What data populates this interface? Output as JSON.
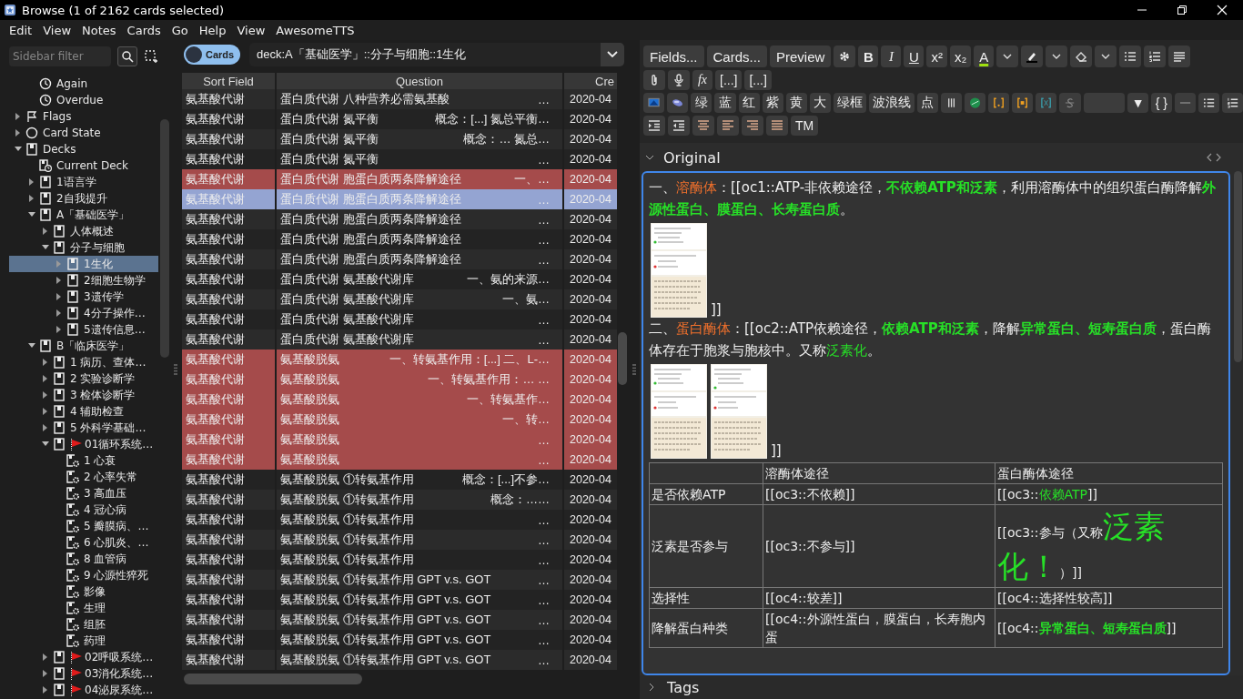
{
  "window": {
    "title": "Browse (1 of 2162 cards selected)"
  },
  "menu": [
    "Edit",
    "View",
    "Notes",
    "Cards",
    "Go",
    "Help",
    "View",
    "AwesomeTTS"
  ],
  "sidebar": {
    "filter": {
      "placeholder": "Sidebar filter"
    },
    "continued_items": [
      {
        "kind": "saved-search",
        "label": "Again",
        "selected": false
      },
      {
        "kind": "saved-search",
        "label": "Overdue",
        "selected": false
      }
    ],
    "items": [
      {
        "kind": "flag",
        "label": "Flags",
        "expanded": false,
        "selected": false
      },
      {
        "kind": "card-state",
        "label": "Card State",
        "expanded": false,
        "selected": false
      },
      {
        "kind": "deck",
        "label": "Decks",
        "expanded": true,
        "selected": false,
        "children": [
          {
            "kind": "current-deck",
            "label": "Current Deck",
            "selected": false
          },
          {
            "kind": "deck",
            "label": "1语言学",
            "expanded": false,
            "selected": false
          },
          {
            "kind": "deck",
            "label": "2自我提升",
            "expanded": false,
            "selected": false
          },
          {
            "kind": "deck",
            "label": "A「基础医学」",
            "expanded": true,
            "selected": false,
            "children": [
              {
                "kind": "deck",
                "label": "人体概述",
                "expanded": false,
                "selected": false
              },
              {
                "kind": "deck",
                "label": "分子与细胞",
                "expanded": true,
                "selected": false,
                "children": [
                  {
                    "kind": "deck",
                    "label": "1生化",
                    "expanded": false,
                    "selected": true
                  },
                  {
                    "kind": "deck",
                    "label": "2细胞生物学",
                    "expanded": false,
                    "selected": false
                  },
                  {
                    "kind": "deck",
                    "label": "3遗传学",
                    "expanded": false,
                    "selected": false
                  },
                  {
                    "kind": "deck",
                    "label": "4分子操作…",
                    "expanded": false,
                    "selected": false
                  },
                  {
                    "kind": "deck",
                    "label": "5遗传信息…",
                    "expanded": false,
                    "selected": false
                  }
                ]
              }
            ]
          },
          {
            "kind": "deck",
            "label": "B「临床医学」",
            "expanded": true,
            "selected": false,
            "children": [
              {
                "kind": "deck",
                "label": "1 病历、查体…",
                "expanded": false,
                "selected": false,
                "flagged": false
              },
              {
                "kind": "deck",
                "label": "2 实验诊断学",
                "expanded": false,
                "selected": false,
                "flagged": false
              },
              {
                "kind": "deck",
                "label": "3 检体诊断学",
                "expanded": false,
                "selected": false,
                "flagged": false
              },
              {
                "kind": "deck",
                "label": "4 辅助检查",
                "expanded": false,
                "selected": false,
                "flagged": false
              },
              {
                "kind": "deck",
                "label": "5 外科学基础…",
                "expanded": false,
                "selected": false,
                "flagged": false
              },
              {
                "kind": "deck",
                "label": "01循环系统…",
                "expanded": true,
                "selected": false,
                "flagged": true,
                "children": [
                  {
                    "kind": "filtered-deck",
                    "label": "1 心衰",
                    "selected": false
                  },
                  {
                    "kind": "filtered-deck",
                    "label": "2 心率失常",
                    "selected": false
                  },
                  {
                    "kind": "filtered-deck",
                    "label": "3 高血压",
                    "selected": false
                  },
                  {
                    "kind": "filtered-deck",
                    "label": "4 冠心病",
                    "selected": false
                  },
                  {
                    "kind": "filtered-deck",
                    "label": "5 瓣膜病、…",
                    "selected": false
                  },
                  {
                    "kind": "filtered-deck",
                    "label": "6 心肌炎、…",
                    "selected": false
                  },
                  {
                    "kind": "filtered-deck",
                    "label": "8 血管病",
                    "selected": false
                  },
                  {
                    "kind": "filtered-deck",
                    "label": "9 心源性猝死",
                    "selected": false
                  },
                  {
                    "kind": "filtered-deck",
                    "label": "影像",
                    "selected": false
                  },
                  {
                    "kind": "filtered-deck",
                    "label": "生理",
                    "selected": false
                  },
                  {
                    "kind": "filtered-deck",
                    "label": "组胚",
                    "selected": false
                  },
                  {
                    "kind": "filtered-deck",
                    "label": "药理",
                    "selected": false
                  }
                ]
              },
              {
                "kind": "deck",
                "label": "02呼吸系统…",
                "expanded": false,
                "selected": false,
                "flagged": true
              },
              {
                "kind": "deck",
                "label": "03消化系统…",
                "expanded": false,
                "selected": false,
                "flagged": true
              },
              {
                "kind": "deck",
                "label": "04泌尿系统…",
                "expanded": false,
                "selected": false,
                "flagged": true
              }
            ]
          }
        ]
      }
    ]
  },
  "browser": {
    "mode_switch": {
      "label": "Cards"
    },
    "search": "deck:A「基础医学」::分子与细胞::1生化",
    "columns": [
      "Sort Field",
      "Question",
      "Cre"
    ],
    "rows": [
      {
        "sort_field": "氨基酸代谢",
        "question": "蛋白质代谢 八种营养必需氨基酸",
        "preview": "…",
        "created": "2020-04",
        "marked": false,
        "selected": false
      },
      {
        "sort_field": "氨基酸代谢",
        "question": "蛋白质代谢 氮平衡",
        "preview": "概念：[...] 氮总平衡…",
        "created": "2020-04",
        "marked": false,
        "selected": false
      },
      {
        "sort_field": "氨基酸代谢",
        "question": "蛋白质代谢 氮平衡",
        "preview": "概念：… 氮总…",
        "created": "2020-04",
        "marked": false,
        "selected": false
      },
      {
        "sort_field": "氨基酸代谢",
        "question": "蛋白质代谢 氮平衡",
        "preview": "…",
        "created": "2020-04",
        "marked": false,
        "selected": false
      },
      {
        "sort_field": "氨基酸代谢",
        "question": "蛋白质代谢 胞蛋白质两条降解途径",
        "preview": "一、…",
        "created": "2020-04",
        "marked": true,
        "selected": false
      },
      {
        "sort_field": "氨基酸代谢",
        "question": "蛋白质代谢 胞蛋白质两条降解途径",
        "preview": "…",
        "created": "2020-04",
        "marked": false,
        "selected": true
      },
      {
        "sort_field": "氨基酸代谢",
        "question": "蛋白质代谢 胞蛋白质两条降解途径",
        "preview": "…",
        "created": "2020-04",
        "marked": false,
        "selected": false
      },
      {
        "sort_field": "氨基酸代谢",
        "question": "蛋白质代谢 胞蛋白质两条降解途径",
        "preview": "…",
        "created": "2020-04",
        "marked": false,
        "selected": false
      },
      {
        "sort_field": "氨基酸代谢",
        "question": "蛋白质代谢 胞蛋白质两条降解途径",
        "preview": "…",
        "created": "2020-04",
        "marked": false,
        "selected": false
      },
      {
        "sort_field": "氨基酸代谢",
        "question": "蛋白质代谢 氨基酸代谢库",
        "preview": "一、氨的来源…",
        "created": "2020-04",
        "marked": false,
        "selected": false
      },
      {
        "sort_field": "氨基酸代谢",
        "question": "蛋白质代谢 氨基酸代谢库",
        "preview": "一、氨…",
        "created": "2020-04",
        "marked": false,
        "selected": false
      },
      {
        "sort_field": "氨基酸代谢",
        "question": "蛋白质代谢 氨基酸代谢库",
        "preview": "…",
        "created": "2020-04",
        "marked": false,
        "selected": false
      },
      {
        "sort_field": "氨基酸代谢",
        "question": "蛋白质代谢 氨基酸代谢库",
        "preview": "…",
        "created": "2020-04",
        "marked": false,
        "selected": false
      },
      {
        "sort_field": "氨基酸代谢",
        "question": "氨基酸脱氨",
        "preview": "一、转氨基作用：[...] 二、L-…",
        "created": "2020-04",
        "marked": true,
        "selected": false
      },
      {
        "sort_field": "氨基酸代谢",
        "question": "氨基酸脱氨",
        "preview": "一、转氨基作用：… …",
        "created": "2020-04",
        "marked": true,
        "selected": false
      },
      {
        "sort_field": "氨基酸代谢",
        "question": "氨基酸脱氨",
        "preview": "一、转氨基作…",
        "created": "2020-04",
        "marked": true,
        "selected": false
      },
      {
        "sort_field": "氨基酸代谢",
        "question": "氨基酸脱氨",
        "preview": "一、转…",
        "created": "2020-04",
        "marked": true,
        "selected": false
      },
      {
        "sort_field": "氨基酸代谢",
        "question": "氨基酸脱氨",
        "preview": "…",
        "created": "2020-04",
        "marked": true,
        "selected": false
      },
      {
        "sort_field": "氨基酸代谢",
        "question": "氨基酸脱氨",
        "preview": "…",
        "created": "2020-04",
        "marked": true,
        "selected": false
      },
      {
        "sort_field": "氨基酸代谢",
        "question": "氨基酸脱氨 ①转氨基作用",
        "preview": "概念：[...]不参…",
        "created": "2020-04",
        "marked": false,
        "selected": false
      },
      {
        "sort_field": "氨基酸代谢",
        "question": "氨基酸脱氨 ①转氨基作用",
        "preview": "概念：……",
        "created": "2020-04",
        "marked": false,
        "selected": false
      },
      {
        "sort_field": "氨基酸代谢",
        "question": "氨基酸脱氨 ①转氨基作用",
        "preview": "…",
        "created": "2020-04",
        "marked": false,
        "selected": false
      },
      {
        "sort_field": "氨基酸代谢",
        "question": "氨基酸脱氨 ①转氨基作用",
        "preview": "…",
        "created": "2020-04",
        "marked": false,
        "selected": false
      },
      {
        "sort_field": "氨基酸代谢",
        "question": "氨基酸脱氨 ①转氨基作用",
        "preview": "…",
        "created": "2020-04",
        "marked": false,
        "selected": false
      },
      {
        "sort_field": "氨基酸代谢",
        "question": "氨基酸脱氨 ①转氨基作用 GPT v.s. GOT",
        "preview": "…",
        "created": "2020-04",
        "marked": false,
        "selected": false
      },
      {
        "sort_field": "氨基酸代谢",
        "question": "氨基酸脱氨 ①转氨基作用 GPT v.s. GOT",
        "preview": "…",
        "created": "2020-04",
        "marked": false,
        "selected": false
      },
      {
        "sort_field": "氨基酸代谢",
        "question": "氨基酸脱氨 ①转氨基作用 GPT v.s. GOT",
        "preview": "…",
        "created": "2020-04",
        "marked": false,
        "selected": false
      },
      {
        "sort_field": "氨基酸代谢",
        "question": "氨基酸脱氨 ①转氨基作用 GPT v.s. GOT",
        "preview": "…",
        "created": "2020-04",
        "marked": false,
        "selected": false
      },
      {
        "sort_field": "氨基酸代谢",
        "question": "氨基酸脱氨 ①转氨基作用 GPT v.s. GOT",
        "preview": "…",
        "created": "2020-04",
        "marked": false,
        "selected": false
      }
    ]
  },
  "editor": {
    "toolbar": [
      [
        {
          "kind": "text",
          "label": "Fields..."
        },
        {
          "kind": "text",
          "label": "Cards..."
        },
        {
          "kind": "text",
          "label": "Preview"
        },
        {
          "kind": "icon"
        },
        {
          "kind": "bold",
          "label": "B"
        },
        {
          "kind": "italic",
          "label": "I"
        },
        {
          "kind": "underline",
          "label": "U"
        },
        {
          "kind": "text",
          "label": "x²"
        },
        {
          "kind": "text",
          "label": "x₂"
        },
        {
          "kind": "text-color",
          "label": "A"
        },
        {
          "kind": "icon"
        },
        {
          "kind": "icon"
        },
        {
          "kind": "icon"
        },
        {
          "kind": "icon"
        },
        {
          "kind": "icon"
        },
        {
          "kind": "icon"
        },
        {
          "kind": "icon"
        },
        {
          "kind": "icon"
        }
      ],
      [
        {
          "kind": "icon"
        },
        {
          "kind": "icon"
        },
        {
          "kind": "italic",
          "label": "fx"
        },
        {
          "kind": "text",
          "label": "[...]"
        },
        {
          "kind": "text",
          "label": "[...]"
        }
      ],
      [
        {
          "kind": "icon"
        },
        {
          "kind": "icon"
        },
        {
          "kind": "text",
          "label": "绿"
        },
        {
          "kind": "text",
          "label": "蓝"
        },
        {
          "kind": "text",
          "label": "红"
        },
        {
          "kind": "text",
          "label": "紫"
        },
        {
          "kind": "text",
          "label": "黄"
        },
        {
          "kind": "text",
          "label": "大"
        },
        {
          "kind": "text",
          "label": "绿框"
        },
        {
          "kind": "text",
          "label": "波浪线"
        },
        {
          "kind": "text",
          "label": "点"
        },
        {
          "kind": "icon"
        },
        {
          "kind": "icon"
        },
        {
          "kind": "icon"
        },
        {
          "kind": "icon"
        },
        {
          "kind": "icon"
        },
        {
          "kind": "icon"
        },
        {
          "kind": "blank"
        },
        {
          "kind": "text",
          "label": "▼"
        },
        {
          "kind": "text",
          "label": "{ }"
        },
        {
          "kind": "icon"
        },
        {
          "kind": "icon"
        },
        {
          "kind": "icon"
        }
      ],
      [
        {
          "kind": "icon"
        },
        {
          "kind": "icon"
        },
        {
          "kind": "icon"
        },
        {
          "kind": "icon"
        },
        {
          "kind": "icon"
        },
        {
          "kind": "icon"
        },
        {
          "kind": "text",
          "label": "TM"
        }
      ]
    ],
    "field": {
      "name": "Original",
      "expanded": true,
      "blocks": [
        {
          "kind": "paragraph",
          "segments": [
            "一、",
            {
              "kind": "orange",
              "text": "溶酶体"
            },
            "：[[oc1::ATP-非依赖途径，",
            {
              "kind": "green-bold",
              "text": "不依赖ATP和泛素"
            },
            "，利用溶酶体中的组织蛋白酶降解",
            {
              "kind": "green-bold",
              "text": "外源性蛋白、膜蛋白、长寿蛋白质"
            },
            "。"
          ]
        },
        {
          "kind": "images",
          "tail": "]]"
        },
        {
          "kind": "paragraph",
          "segments": [
            "二、",
            {
              "kind": "orange",
              "text": "蛋白酶体"
            },
            "：[[oc2::ATP依赖途径，",
            {
              "kind": "green-bold",
              "text": "依赖ATP和泛素"
            },
            "，降解",
            {
              "kind": "green-bold",
              "text": "异常蛋白、短寿蛋白质"
            },
            "，蛋白酶体存在于胞浆与胞核中。又称",
            {
              "kind": "green",
              "text": "泛素化"
            },
            "。"
          ]
        },
        {
          "kind": "images",
          "tail": "]]"
        },
        {
          "kind": "table",
          "header": [
            "溶酶体途径",
            "蛋白酶体途径"
          ],
          "rows": [
            {
              "label": "是否依赖ATP",
              "cells": [
                [
                  "[[oc3::不依赖]]"
                ],
                [
                  "[[oc3::",
                  {
                    "kind": "green",
                    "text": "依赖ATP"
                  },
                  "]]"
                ]
              ]
            },
            {
              "label": "泛素是否参与",
              "cells": [
                [
                  "[[oc3::不参与]]"
                ],
                [
                  "[[oc3::参与（又称",
                  {
                    "kind": "green-large",
                    "text": "泛素化！"
                  },
                  "）]]"
                ]
              ]
            },
            {
              "label": "选择性",
              "cells": [
                [
                  "[[oc4::较差]]"
                ],
                [
                  "[[oc4::选择性较高]]"
                ]
              ]
            },
            {
              "label": "降解蛋白种类",
              "cells": [
                [
                  "[[oc4::外源性蛋白，膜蛋白，长寿胞内蛋"
                ],
                [
                  "[[oc4::",
                  {
                    "kind": "green-bold",
                    "text": "异常蛋白、短寿蛋白质"
                  },
                  "]]"
                ]
              ]
            }
          ]
        }
      ]
    },
    "tags": {
      "label": "Tags",
      "expanded": false
    }
  }
}
